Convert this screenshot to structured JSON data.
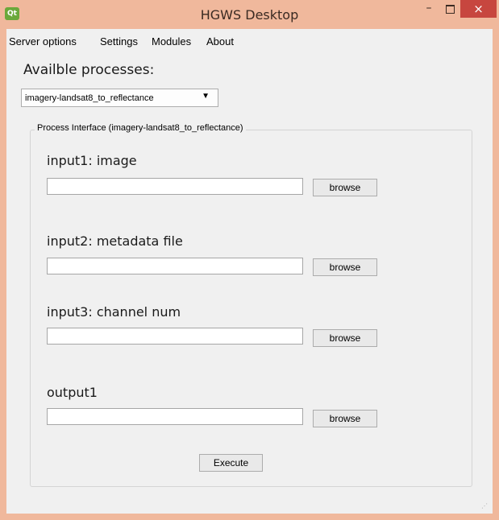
{
  "window": {
    "title": "HGWS Desktop",
    "icon": "qt-logo-icon",
    "close_glyph": "×",
    "minimize_glyph": "–"
  },
  "menubar": {
    "items": [
      "Server options",
      "Settings",
      "Modules",
      "About"
    ]
  },
  "processes": {
    "label": "Availble processes:",
    "selected": "imagery-landsat8_to_reflectance"
  },
  "interface": {
    "title": "Process Interface (imagery-landsat8_to_reflectance)",
    "fields": [
      {
        "label": "input1: image",
        "value": "",
        "button": "browse"
      },
      {
        "label": "input2: metadata file",
        "value": "",
        "button": "browse"
      },
      {
        "label": "input3: channel num",
        "value": "",
        "button": "browse"
      },
      {
        "label": "output1",
        "value": "",
        "button": "browse"
      }
    ],
    "execute_label": "Execute"
  },
  "colors": {
    "titlebar": "#f0b89c",
    "close": "#c7463f",
    "background": "#f0f0f0"
  }
}
